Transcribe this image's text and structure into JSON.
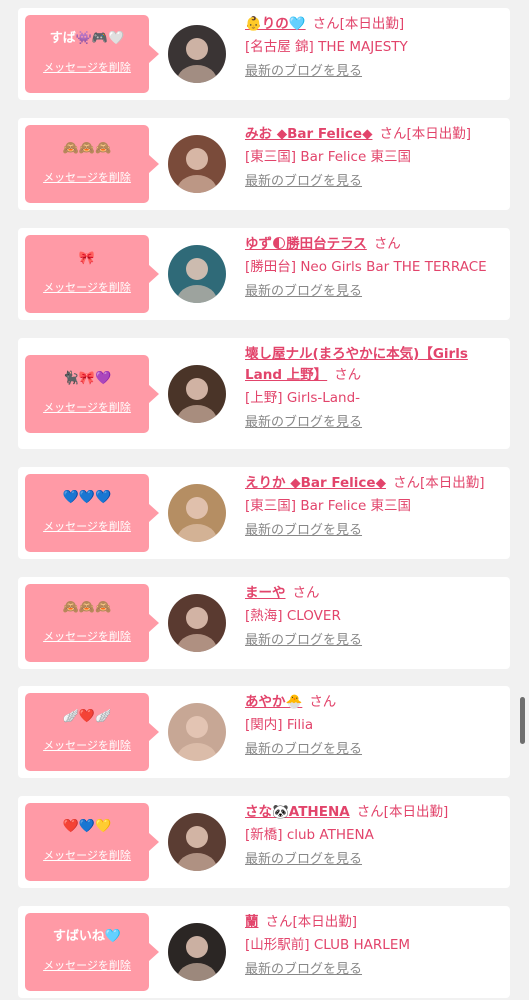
{
  "list": {
    "delete_label": "メッセージを削除",
    "blog_label": "最新のブログを見る",
    "items": [
      {
        "message": "すば👾🎮🤍",
        "name": "👶りの🩵",
        "suffix": "さん[本日出勤]",
        "shop": "[名古屋 錦] THE MAJESTY",
        "avatar_color": "#3a3434"
      },
      {
        "message": "🙈🙈🙈",
        "name": "みお ◆Bar Felice◆",
        "suffix": "さん[本日出勤]",
        "shop": "[東三国] Bar Felice 東三国",
        "avatar_color": "#7a4b3a"
      },
      {
        "message": "🎀",
        "name": "ゆず🌓勝田台テラス",
        "suffix": "さん",
        "shop": "[勝田台] Neo Girls Bar THE TERRACE",
        "avatar_color": "#2f6a78"
      },
      {
        "message": "🐈‍⬛🎀💜",
        "name": "壊し屋ナル(まろやかに本気)【Girls Land 上野】",
        "suffix": "さん",
        "shop": "[上野] Girls-Land-",
        "avatar_color": "#4a3428"
      },
      {
        "message": "💙💙💙",
        "name": "えりか ◆Bar Felice◆",
        "suffix": "さん[本日出勤]",
        "shop": "[東三国] Bar Felice 東三国",
        "avatar_color": "#b58e63"
      },
      {
        "message": "🙈🙈🙈",
        "name": "まーや",
        "suffix": "さん",
        "shop": "[熱海] CLOVER",
        "avatar_color": "#5a3a30"
      },
      {
        "message": "🪽❤️🪽",
        "name": "あやか🐣",
        "suffix": "さん",
        "shop": "[関内] Filia",
        "avatar_color": "#c7a795"
      },
      {
        "message": "❤️💙💛",
        "name": "さな🐼ATHENA",
        "suffix": "さん[本日出勤]",
        "shop": "[新橋] club ATHENA",
        "avatar_color": "#5b3d33"
      },
      {
        "message": "すばいね🩵",
        "name": "蘭",
        "suffix": "さん[本日出勤]",
        "shop": "[山形駅前] CLUB HARLEM",
        "avatar_color": "#2b2624"
      }
    ]
  }
}
